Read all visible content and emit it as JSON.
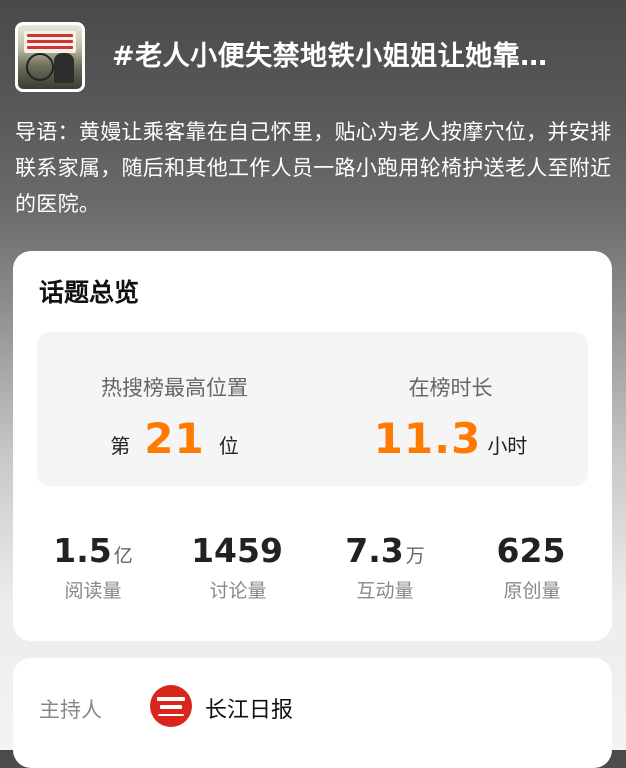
{
  "header": {
    "thumbnail_icon": "news-video-thumbnail",
    "title": "#老人小便失禁地铁小姐姐让她靠…"
  },
  "intro": {
    "text": "导语：黄嫚让乘客靠在自己怀里，贴心为老人按摩穴位，并安排联系家属，随后和其他工作人员一路小跑用轮椅护送老人至附近的医院。"
  },
  "overview": {
    "title": "话题总览",
    "highest_rank": {
      "label": "热搜榜最高位置",
      "prefix": "第",
      "value": "21",
      "suffix": "位"
    },
    "duration": {
      "label": "在榜时长",
      "value": "11.3",
      "unit": "小时"
    },
    "stats": [
      {
        "value": "1.5",
        "unit": "亿",
        "label": "阅读量"
      },
      {
        "value": "1459",
        "unit": "",
        "label": "讨论量"
      },
      {
        "value": "7.3",
        "unit": "万",
        "label": "互动量"
      },
      {
        "value": "625",
        "unit": "",
        "label": "原创量"
      }
    ],
    "accent_color": "#ff7a00"
  },
  "host": {
    "label": "主持人",
    "logo_icon": "changjiang-daily-logo",
    "name": "长江日报"
  }
}
